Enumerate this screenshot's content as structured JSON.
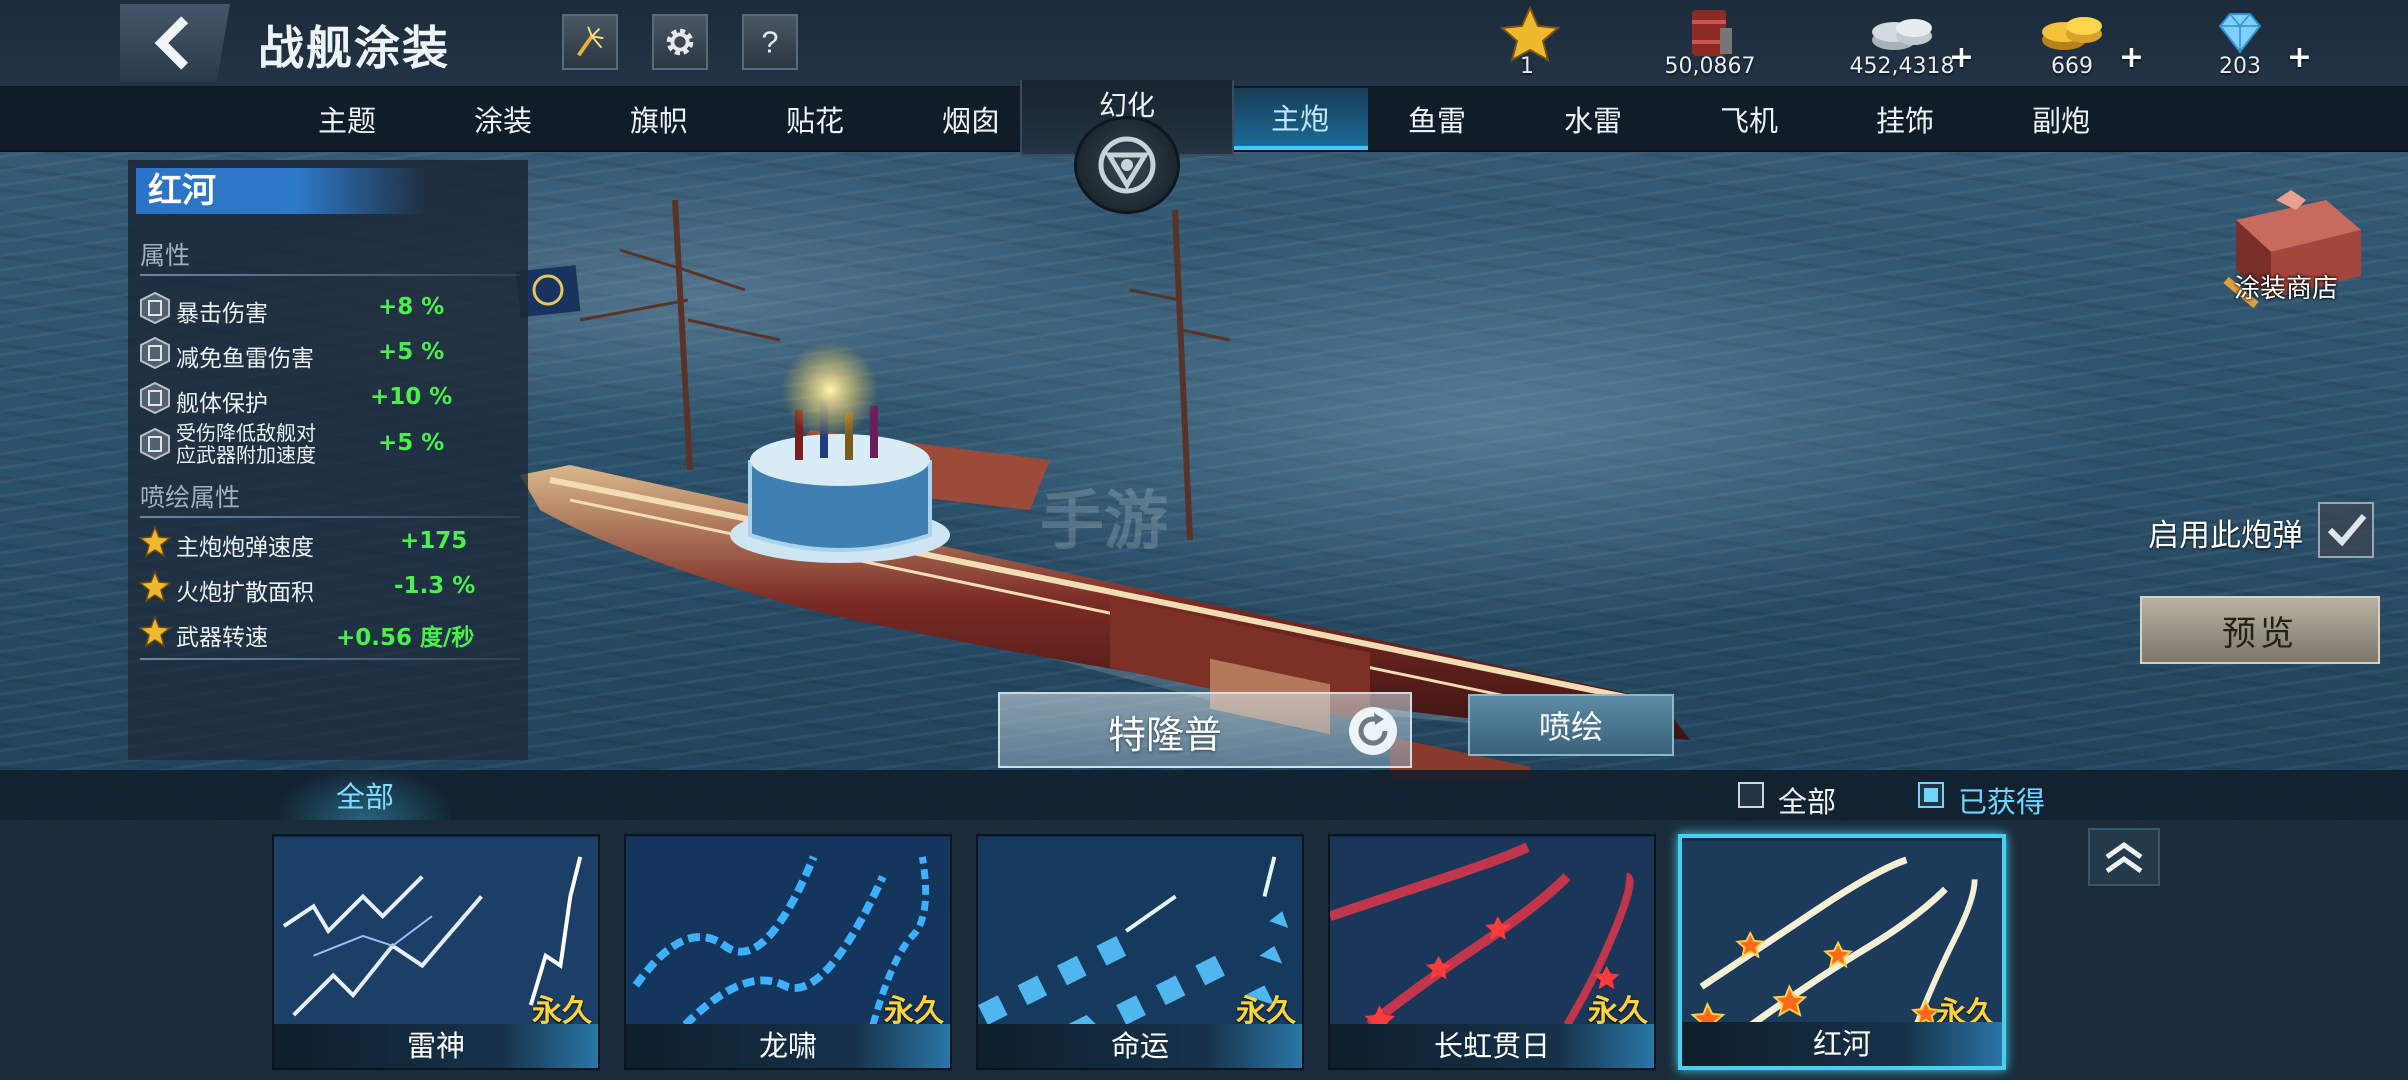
{
  "header": {
    "title": "战舰涂装",
    "resources": [
      {
        "icon": "star-icon",
        "value": "1",
        "has_plus": false
      },
      {
        "icon": "fuel-barrel-icon",
        "value": "50,0867",
        "has_plus": false
      },
      {
        "icon": "silver-coins-icon",
        "value": "452,4318",
        "has_plus": true
      },
      {
        "icon": "gold-coins-icon",
        "value": "669",
        "has_plus": true
      },
      {
        "icon": "diamond-icon",
        "value": "203",
        "has_plus": true
      }
    ],
    "plus_symbol": "+"
  },
  "tabs": {
    "left": [
      "主题",
      "涂装",
      "旗帜",
      "贴花",
      "烟囱"
    ],
    "center": "幻化",
    "right": [
      "主炮",
      "鱼雷",
      "水雷",
      "飞机",
      "挂饰",
      "副炮"
    ],
    "active": "主炮"
  },
  "skin_panel": {
    "name": "红河",
    "attributes_label": "属性",
    "attributes": [
      {
        "name": "暴击伤害",
        "value": "+8 %"
      },
      {
        "name": "减免鱼雷伤害",
        "value": "+5 %"
      },
      {
        "name": "舰体保护",
        "value": "+10 %"
      },
      {
        "name": "受伤降低敌舰对应武器附加速度",
        "value": "+5 %",
        "name_line1": "受伤降低敌舰对",
        "name_line2": "应武器附加速度"
      }
    ],
    "paint_attributes_label": "喷绘属性",
    "paint_attributes": [
      {
        "name": "主炮炮弹速度",
        "value": "+175"
      },
      {
        "name": "火炮扩散面积",
        "value": "-1.3 %"
      },
      {
        "name": "武器转速",
        "value": "+0.56 度/秒"
      }
    ]
  },
  "scene": {
    "watermark": "手游",
    "ship_name": "特隆普",
    "spray_button": "喷绘"
  },
  "right_controls": {
    "shop_label": "涂装商店",
    "enable_label": "启用此炮弹",
    "enable_checked": true,
    "preview_button": "预览"
  },
  "filters": {
    "category_tab": "全部",
    "options": [
      {
        "label": "全部",
        "checked": false
      },
      {
        "label": "已获得",
        "checked": true
      }
    ]
  },
  "cards": [
    {
      "name": "雷神",
      "tag": "永久",
      "selected": false,
      "effect": "lightning"
    },
    {
      "name": "龙啸",
      "tag": "永久",
      "selected": false,
      "effect": "blue-swirl"
    },
    {
      "name": "命运",
      "tag": "永久",
      "selected": false,
      "effect": "chevrons"
    },
    {
      "name": "长虹贯日",
      "tag": "永久",
      "selected": false,
      "effect": "red-stars"
    },
    {
      "name": "红河",
      "tag": "永久",
      "selected": true,
      "effect": "gold-stars"
    }
  ],
  "colors": {
    "accent": "#46c7ff",
    "positive": "#4cf04c",
    "permanent_tag": "#ffd43a",
    "selected_border": "#48d0f0"
  }
}
